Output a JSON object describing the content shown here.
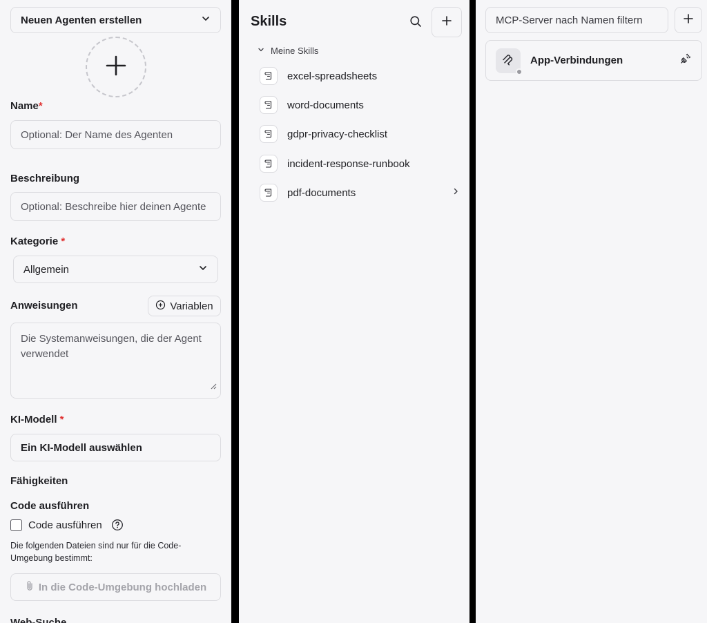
{
  "agent_form": {
    "header_dropdown": "Neuen Agenten erstellen",
    "name": {
      "label": "Name",
      "required_mark": "*",
      "placeholder": "Optional: Der Name des Agenten"
    },
    "description": {
      "label": "Beschreibung",
      "placeholder": "Optional: Beschreibe hier deinen Agente"
    },
    "category": {
      "label": "Kategorie",
      "required_mark": "*",
      "selected": "Allgemein"
    },
    "instructions": {
      "label": "Anweisungen",
      "variables_button": "Variablen",
      "placeholder": "Die Systemanweisungen, die der Agent verwendet"
    },
    "model": {
      "label": "KI-Modell",
      "required_mark": "*",
      "placeholder": "Ein KI-Modell auswählen"
    },
    "capabilities_heading": "Fähigkeiten",
    "code_section_heading": "Code ausführen",
    "code_checkbox_label": "Code ausführen",
    "code_note": "Die folgenden Dateien sind nur für die Code-Umgebung bestimmt:",
    "upload_button": "In die Code-Umgebung hochladen",
    "next_heading_partial": "Web-Suche"
  },
  "skills": {
    "title": "Skills",
    "group_label": "Meine Skills",
    "items": [
      {
        "name": "excel-spreadsheets"
      },
      {
        "name": "word-documents"
      },
      {
        "name": "gdpr-privacy-checklist"
      },
      {
        "name": "incident-response-runbook"
      },
      {
        "name": "pdf-documents"
      }
    ]
  },
  "mcp": {
    "filter_placeholder": "MCP-Server nach Namen filtern",
    "servers": [
      {
        "name": "App-Verbindungen",
        "status": "offline"
      }
    ]
  },
  "colors": {
    "required": "#e03131",
    "panel_bg": "#f6f6f8",
    "border": "#dcdce0",
    "status_dot": "#9a9aa0"
  }
}
